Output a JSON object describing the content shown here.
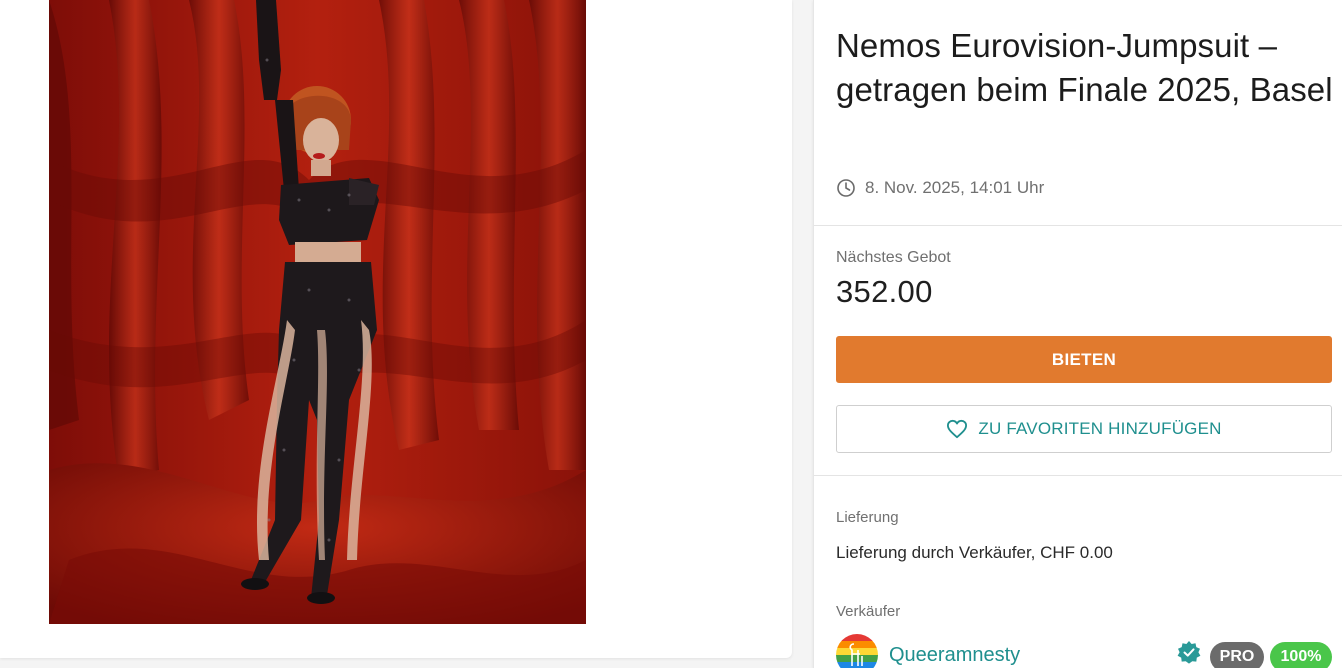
{
  "listing": {
    "title": "Nemos Eurovision-Jumpsuit – getragen beim Finale 2025, Basel",
    "date": "8. Nov. 2025, 14:01 Uhr",
    "photo_icon": "product-photo"
  },
  "bid": {
    "label": "Nächstes Gebot",
    "value": "352.00",
    "button_label": "BIETEN"
  },
  "favorites": {
    "button_label": "ZU FAVORITEN HINZUFÜGEN"
  },
  "delivery": {
    "label": "Lieferung",
    "text": "Lieferung durch Verkäufer, CHF 0.00"
  },
  "seller": {
    "label": "Verkäufer",
    "name": "Queeramnesty",
    "pro_badge": "PRO",
    "rating": "100%"
  },
  "colors": {
    "accent_orange": "#e17a2e",
    "accent_teal": "#1f8f8e",
    "rating_green": "#4ac64a",
    "pro_gray": "#6b6b6b"
  }
}
